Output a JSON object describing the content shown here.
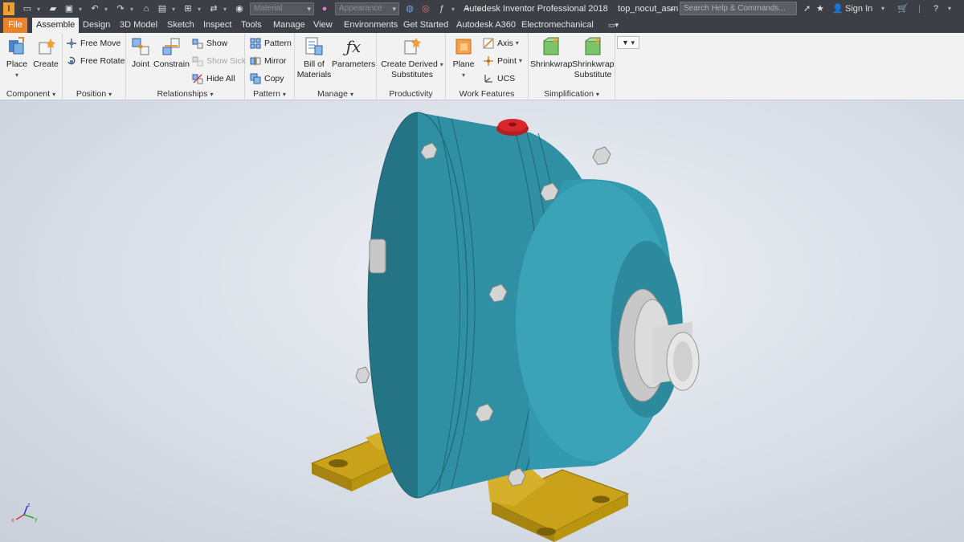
{
  "app": {
    "logo_letter": "I",
    "title": "Autodesk Inventor Professional 2018",
    "document": "top_nocut_asm",
    "search_placeholder": "Search Help & Commands...",
    "sign_in": "Sign In",
    "material_select": "Material",
    "appearance_select": "Appearance"
  },
  "tabs": [
    "File",
    "Assemble",
    "Design",
    "3D Model",
    "Sketch",
    "Inspect",
    "Tools",
    "Manage",
    "View",
    "Environments",
    "Get Started",
    "Autodesk A360",
    "Electromechanical"
  ],
  "active_tab": "Assemble",
  "ribbon": {
    "component": {
      "label": "Component",
      "place": "Place",
      "create": "Create"
    },
    "position": {
      "label": "Position",
      "free_move": "Free Move",
      "free_rotate": "Free Rotate"
    },
    "relationships": {
      "label": "Relationships",
      "joint": "Joint",
      "constrain": "Constrain",
      "show": "Show",
      "show_sick": "Show Sick",
      "hide_all": "Hide All"
    },
    "pattern": {
      "label": "Pattern",
      "pattern": "Pattern",
      "mirror": "Mirror",
      "copy": "Copy"
    },
    "manage": {
      "label": "Manage",
      "bom_line1": "Bill of",
      "bom_line2": "Materials",
      "parameters": "Parameters"
    },
    "productivity": {
      "label": "Productivity",
      "line1": "Create Derived",
      "line2": "Substitutes"
    },
    "work_features": {
      "label": "Work Features",
      "plane": "Plane",
      "axis": "Axis",
      "point": "Point",
      "ucs": "UCS"
    },
    "simplification": {
      "label": "Simplification",
      "shrinkwrap": "Shrinkwrap",
      "sub_line1": "Shrinkwrap",
      "sub_line2": "Substitute"
    }
  },
  "colors": {
    "body_teal": "#2f8fa3",
    "base_yellow": "#c9a21a",
    "plug_red": "#d8262a",
    "file_tab": "#e8822b"
  },
  "icons": [
    "save-icon",
    "undo-icon",
    "redo-icon",
    "home-icon",
    "star-icon",
    "user-icon",
    "cart-icon",
    "help-icon"
  ]
}
